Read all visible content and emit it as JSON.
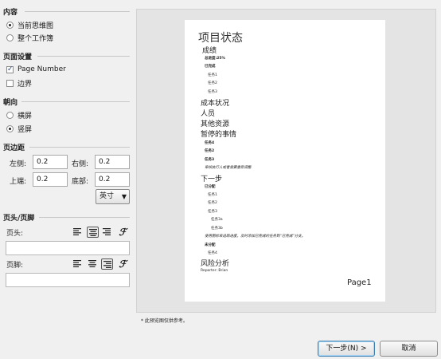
{
  "content": {
    "heading": "内容",
    "options": [
      {
        "label": "当前思维图",
        "selected": true
      },
      {
        "label": "整个工作簿",
        "selected": false
      }
    ]
  },
  "page_setup": {
    "heading": "页面设置",
    "page_number": {
      "label": "Page Number",
      "checked": true
    },
    "border": {
      "label": "边界",
      "checked": false
    }
  },
  "orientation": {
    "heading": "朝向",
    "options": [
      {
        "label": "横屏",
        "selected": false
      },
      {
        "label": "竖屏",
        "selected": true
      }
    ]
  },
  "margins": {
    "heading": "页边距",
    "left_label": "左侧:",
    "left_value": "0.2",
    "right_label": "右侧:",
    "right_value": "0.2",
    "top_label": "上端:",
    "top_value": "0.2",
    "bottom_label": "底部:",
    "bottom_value": "0.2",
    "unit": "英寸"
  },
  "header_footer": {
    "heading": "页头/页脚",
    "header_label": "页头:",
    "footer_label": "页脚:",
    "header_value": "",
    "footer_value": "",
    "header_align": "center",
    "footer_align": "right"
  },
  "preview": {
    "title": "项目状态",
    "lines": [
      {
        "text": "成绩",
        "size": "h1"
      },
      {
        "text": "总进度:25%",
        "size": "tiny",
        "bold": true
      },
      {
        "text": "已完成",
        "size": "tiny",
        "bold": true
      },
      {
        "text": "任务1",
        "size": "tiny"
      },
      {
        "text": "任务2",
        "size": "tiny"
      },
      {
        "text": "任务3",
        "size": "tiny"
      },
      {
        "text": "成本状况",
        "size": "h1"
      },
      {
        "text": "人员",
        "size": "h1"
      },
      {
        "text": "其他资源",
        "size": "h1"
      },
      {
        "text": "暂停的事情",
        "size": "h1"
      },
      {
        "text": "任务4",
        "size": "tiny",
        "bold": true
      },
      {
        "text": "任务2",
        "size": "tiny",
        "bold": true
      },
      {
        "text": "任务3",
        "size": "tiny",
        "bold": true
      },
      {
        "text": "审核执行人或者需要重新调整",
        "size": "tiny",
        "italic": true
      },
      {
        "text": "下一步",
        "size": "h1"
      },
      {
        "text": "已分配",
        "size": "tiny",
        "bold": true
      },
      {
        "text": "任务1",
        "size": "tiny"
      },
      {
        "text": "任务2",
        "size": "tiny"
      },
      {
        "text": "任务3",
        "size": "tiny"
      },
      {
        "text": "任务3a",
        "size": "tiny"
      },
      {
        "text": "任务3b",
        "size": "tiny"
      },
      {
        "text": "使用图标来追踪进度，及时添加已完成的任务到“已完成”分支。",
        "size": "tiny",
        "italic": true
      },
      {
        "text": "未分配",
        "size": "tiny",
        "bold": true
      },
      {
        "text": "任务4",
        "size": "tiny"
      },
      {
        "text": "风险分析",
        "size": "h1"
      },
      {
        "text": "Reporter: Brian",
        "size": "tiny"
      }
    ],
    "page_label": "Page1",
    "note": "* 此预览图仅供参考。"
  },
  "buttons": {
    "next": "下一步(N) >",
    "cancel": "取消"
  },
  "colors": {
    "background": "#f0f0f0",
    "preview_background": "#e4e4e4",
    "paper": "#ffffff",
    "primary_button_border": "#3c7fb1"
  },
  "icons": [
    "radio-button",
    "checkbox",
    "align-left-icon",
    "align-center-icon",
    "align-right-icon",
    "format-text-icon",
    "chevron-down-icon"
  ]
}
